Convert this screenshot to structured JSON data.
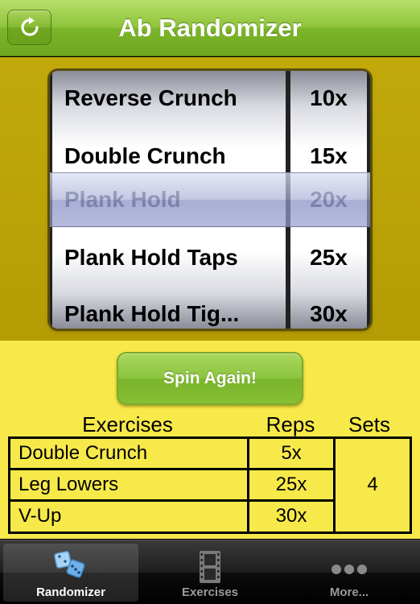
{
  "navbar": {
    "title": "Ab Randomizer",
    "refresh_icon": "refresh-icon"
  },
  "picker": {
    "exercises": [
      "Reverse Crunch",
      "Double Crunch",
      "Plank Hold",
      "Plank Hold Taps",
      "Plank Hold Tig..."
    ],
    "reps": [
      "10x",
      "15x",
      "20x",
      "25x",
      "30x"
    ],
    "selected_index": 2
  },
  "spin_button": {
    "label": "Spin Again!"
  },
  "table": {
    "headers": {
      "exercises": "Exercises",
      "reps": "Reps",
      "sets": "Sets"
    },
    "rows": [
      {
        "exercise": "Double Crunch",
        "reps": "5x"
      },
      {
        "exercise": "Leg Lowers",
        "reps": "25x"
      },
      {
        "exercise": "V-Up",
        "reps": "30x"
      }
    ],
    "sets": "4"
  },
  "tabbar": {
    "items": [
      {
        "label": "Randomizer",
        "icon": "dice-icon",
        "active": true
      },
      {
        "label": "Exercises",
        "icon": "film-strip-icon",
        "active": false
      },
      {
        "label": "More...",
        "icon": "more-dots-icon",
        "active": false
      }
    ]
  },
  "colors": {
    "nav_green": "#8fc43c",
    "picker_bg": "#bfa70a",
    "panel_yellow": "#f7e94a",
    "selection_blue": "#aab0d6"
  }
}
